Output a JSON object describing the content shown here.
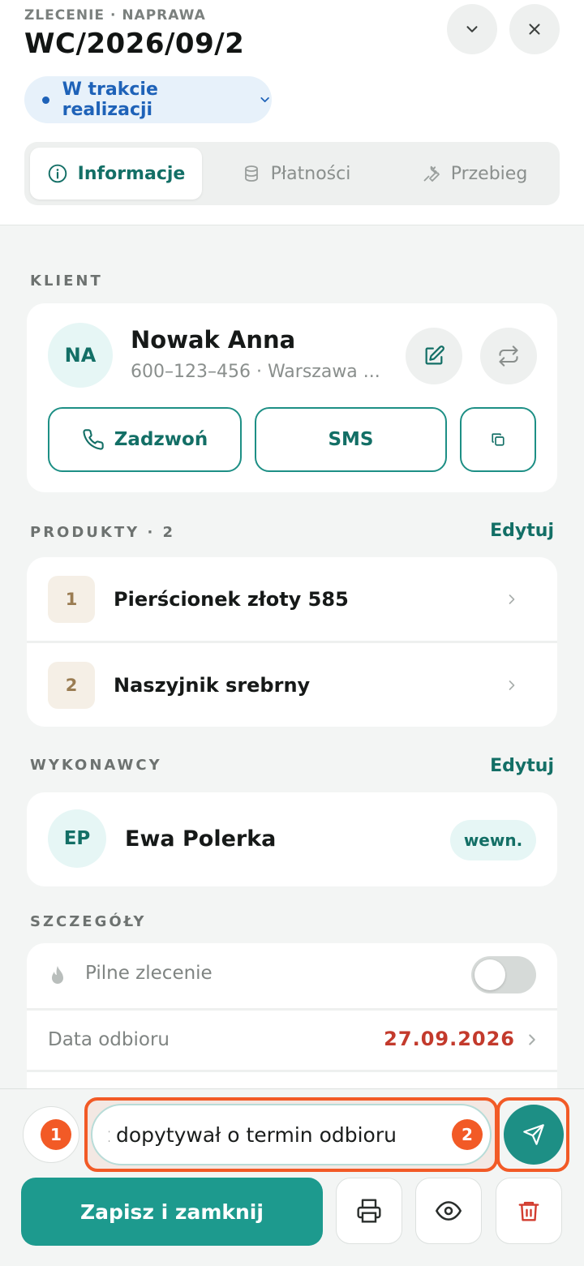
{
  "header": {
    "kicker": "ZLECENIE · NAPRAWA",
    "order_number": "WC/2026/09/2",
    "status": "W trakcie realizacji",
    "tabs": [
      {
        "label": "Informacje",
        "icon": "info-icon",
        "active": true
      },
      {
        "label": "Płatności",
        "icon": "database-icon",
        "active": false
      },
      {
        "label": "Przebieg",
        "icon": "wrench-icon",
        "active": false
      }
    ]
  },
  "client": {
    "section_label": "KLIENT",
    "initials": "NA",
    "name": "Nowak Anna",
    "subtitle": "600–123–456 · Warszawa ...",
    "call_label": "Zadzwoń",
    "sms_label": "SMS"
  },
  "products": {
    "section_label": "PRODUKTY · 2",
    "edit_label": "Edytuj",
    "items": [
      {
        "num": "1",
        "name": "Pierścionek złoty 585"
      },
      {
        "num": "2",
        "name": "Naszyjnik srebrny"
      }
    ]
  },
  "contractors": {
    "section_label": "WYKONAWCY",
    "edit_label": "Edytuj",
    "initials": "EP",
    "name": "Ewa Polerka",
    "tag": "wewn."
  },
  "details": {
    "section_label": "SZCZEGÓŁY",
    "urgent_label": "Pilne zlecenie",
    "urgent_on": false,
    "pickup_label": "Data odbioru",
    "pickup_date": "27.09.2026"
  },
  "bottom": {
    "note_value": "ent dopytywał o termin odbioru",
    "badge_1": "1",
    "badge_2": "2",
    "save_label": "Zapisz i zamknij"
  },
  "colors": {
    "accent": "#1d9a8e",
    "status_blue": "#1e62b8",
    "date_red": "#c33a2c",
    "highlight_orange": "#f25a26"
  }
}
